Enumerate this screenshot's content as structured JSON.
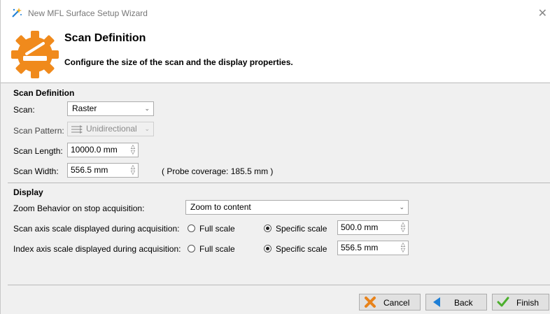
{
  "window": {
    "title": "New MFL Surface Setup Wizard",
    "close_glyph": "✕"
  },
  "banner": {
    "heading": "Scan Definition",
    "subheading": "Configure the size of the scan and the display properties."
  },
  "scan_definition": {
    "section_title": "Scan Definition",
    "scan": {
      "label": "Scan:",
      "value": "Raster"
    },
    "scan_pattern": {
      "label": "Scan Pattern:",
      "value": "Unidirectional"
    },
    "scan_length": {
      "label": "Scan Length:",
      "value": "10000.0 mm"
    },
    "scan_width": {
      "label": "Scan Width:",
      "value": "556.5 mm",
      "note": "( Probe coverage: 185.5 mm )"
    }
  },
  "display": {
    "section_title": "Display",
    "zoom_behavior": {
      "label": "Zoom Behavior on stop acquisition:",
      "value": "Zoom to content"
    },
    "scan_axis": {
      "label": "Scan axis scale displayed during acquisition:",
      "full_label": "Full scale",
      "specific_label": "Specific scale",
      "selected": "specific",
      "value": "500.0 mm"
    },
    "index_axis": {
      "label": "Index axis scale displayed during acquisition:",
      "full_label": "Full scale",
      "specific_label": "Specific scale",
      "selected": "specific",
      "value": "556.5 mm"
    }
  },
  "buttons": {
    "cancel": "Cancel",
    "back": "Back",
    "finish": "Finish"
  },
  "icons": {
    "title": "wand-icon",
    "banner": "gear-scanner-icon",
    "cancel": "x-icon",
    "back": "back-arrow-icon",
    "finish": "checkmark-icon"
  },
  "colors": {
    "accent_orange": "#f08a1c",
    "back_blue": "#1e7fd6",
    "finish_green": "#4caf2e",
    "cancel_orange": "#e8831b"
  }
}
